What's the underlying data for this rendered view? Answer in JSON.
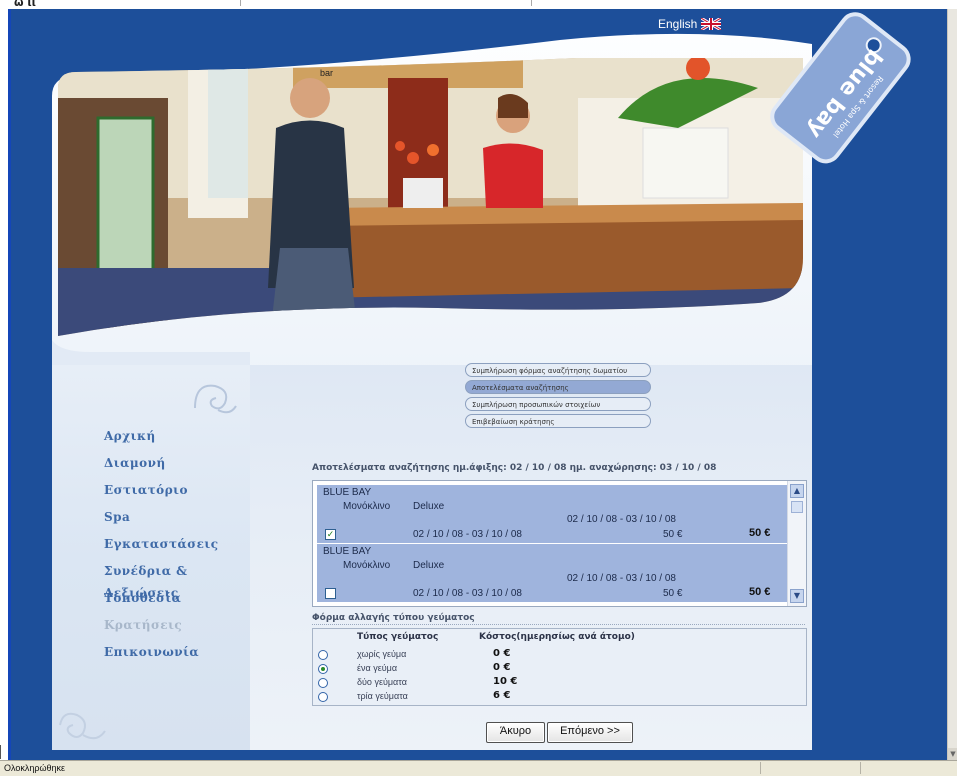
{
  "window": {
    "title_fragment": "ώ ιι",
    "status_text": "Ολοκληρώθηκε"
  },
  "header": {
    "language_label": "English",
    "logo_text": "blue bay",
    "logo_subtitle": "Resort & Spa Hotel"
  },
  "photo": {
    "bar_sign": "bar"
  },
  "nav": {
    "items": [
      {
        "label": "Αρχική",
        "enabled": true
      },
      {
        "label": "Διαμονή",
        "enabled": true
      },
      {
        "label": "Εστιατόριο",
        "enabled": true
      },
      {
        "label": "Spa",
        "enabled": true
      },
      {
        "label": "Εγκαταστάσεις",
        "enabled": true
      },
      {
        "label": "Συνέδρια & Δεξιώσεις",
        "enabled": true
      },
      {
        "label": "Τοποθεσία",
        "enabled": true
      },
      {
        "label": "Κρατήσεις",
        "enabled": false
      },
      {
        "label": "Επικοινωνία",
        "enabled": true
      }
    ]
  },
  "steps": [
    {
      "label": "Συμπλήρωση φόρμας αναζήτησης δωματίου",
      "active": false
    },
    {
      "label": "Αποτελέσματα αναζήτησης",
      "active": true
    },
    {
      "label": "Συμπλήρωση προσωπικών στοιχείων",
      "active": false
    },
    {
      "label": "Επιβεβαίωση κράτησης",
      "active": false
    }
  ],
  "results": {
    "heading": "Αποτελέσματα αναζήτησης ημ.άφιξης: 02 / 10 / 08 ημ. αναχώρησης: 03 / 10 / 08",
    "rows": [
      {
        "hotel": "BLUE BAY",
        "room": "Μονόκλινο",
        "type": "Deluxe",
        "range": "02 / 10 / 08 - 03 / 10 / 08",
        "dates": "02 / 10 / 08 - 03 / 10 / 08",
        "price": "50 €",
        "total": "50 €",
        "checked": true,
        "check_mark": "✓"
      },
      {
        "hotel": "BLUE BAY",
        "room": "Μονόκλινο",
        "type": "Deluxe",
        "range": "02 / 10 / 08 - 03 / 10 / 08",
        "dates": "02 / 10 / 08 - 03 / 10 / 08",
        "price": "50 €",
        "total": "50 €",
        "checked": false,
        "check_mark": ""
      }
    ]
  },
  "meals": {
    "title": "Φόρμα αλλαγής τύπου γεύματος",
    "col_type": "Τύπος γεύματος",
    "col_cost": "Κόστος(ημερησίως ανά άτομο)",
    "options": [
      {
        "label": "χωρίς γεύμα",
        "price": "0 €",
        "selected": false
      },
      {
        "label": "ένα γεύμα",
        "price": "0 €",
        "selected": true
      },
      {
        "label": "δύο γεύματα",
        "price": "10 €",
        "selected": false
      },
      {
        "label": "τρία γεύματα",
        "price": "6 €",
        "selected": false
      }
    ]
  },
  "buttons": {
    "cancel": "Άκυρο",
    "next": "Επόμενο >>"
  },
  "colors": {
    "frame_blue": "#1d4f9a",
    "accent_blue": "#3f6aa7",
    "result_row": "#9fb4dd",
    "active_step": "#93a9d4"
  }
}
